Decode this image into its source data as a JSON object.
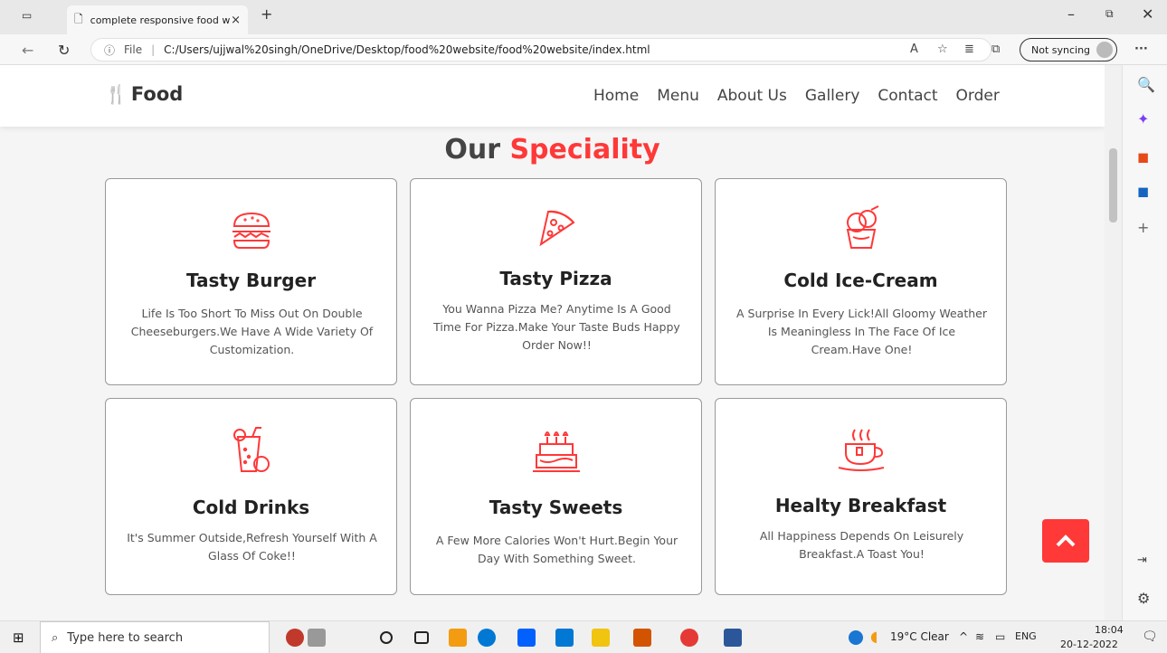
{
  "browser": {
    "tab_title": "complete responsive food websit",
    "tab_close": "×",
    "new_tab": "+",
    "url_scheme": "File",
    "url": "C:/Users/ujjwal%20singh/OneDrive/Desktop/food%20website/food%20website/index.html",
    "sync_label": "Not syncing"
  },
  "site": {
    "logo": "Food",
    "nav": [
      "Home",
      "Menu",
      "About Us",
      "Gallery",
      "Contact",
      "Order"
    ],
    "heading_main": "Our",
    "heading_accent": "Speciality",
    "accent_color": "#ff3838"
  },
  "cards": [
    {
      "title": "Tasty Burger",
      "desc": "Life Is Too Short To Miss Out On Double Cheeseburgers.We Have A Wide Variety Of Customization.",
      "icon": "burger-icon"
    },
    {
      "title": "Tasty Pizza",
      "desc": "You Wanna Pizza Me? Anytime Is A Good Time For Pizza.Make Your Taste Buds Happy Order Now!!",
      "icon": "pizza-icon"
    },
    {
      "title": "Cold Ice-Cream",
      "desc": "A Surprise In Every Lick!All Gloomy Weather Is Meaningless In The Face Of Ice Cream.Have One!",
      "icon": "ice-cream-icon"
    },
    {
      "title": "Cold Drinks",
      "desc": "It's Summer Outside,Refresh Yourself With A Glass Of Coke!!",
      "icon": "drink-icon"
    },
    {
      "title": "Tasty Sweets",
      "desc": "A Few More Calories Won't Hurt.Begin Your Day With Something Sweet.",
      "icon": "cake-icon"
    },
    {
      "title": "Healty Breakfast",
      "desc": "All Happiness Depends On Leisurely Breakfast.A Toast You!",
      "icon": "coffee-cup-icon"
    }
  ],
  "taskbar": {
    "search_placeholder": "Type here to search",
    "weather": "19°C  Clear",
    "lang": "ENG",
    "time": "18:04",
    "date": "20-12-2022"
  }
}
